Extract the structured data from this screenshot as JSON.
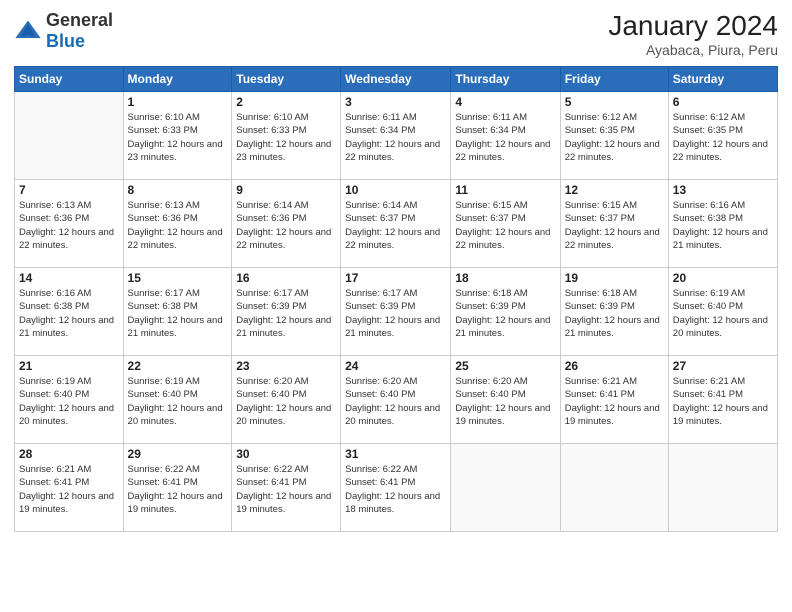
{
  "header": {
    "logo_general": "General",
    "logo_blue": "Blue",
    "month_year": "January 2024",
    "location": "Ayabaca, Piura, Peru"
  },
  "days_of_week": [
    "Sunday",
    "Monday",
    "Tuesday",
    "Wednesday",
    "Thursday",
    "Friday",
    "Saturday"
  ],
  "weeks": [
    [
      {
        "day": "",
        "sunrise": "",
        "sunset": "",
        "daylight": ""
      },
      {
        "day": "1",
        "sunrise": "Sunrise: 6:10 AM",
        "sunset": "Sunset: 6:33 PM",
        "daylight": "Daylight: 12 hours and 23 minutes."
      },
      {
        "day": "2",
        "sunrise": "Sunrise: 6:10 AM",
        "sunset": "Sunset: 6:33 PM",
        "daylight": "Daylight: 12 hours and 23 minutes."
      },
      {
        "day": "3",
        "sunrise": "Sunrise: 6:11 AM",
        "sunset": "Sunset: 6:34 PM",
        "daylight": "Daylight: 12 hours and 22 minutes."
      },
      {
        "day": "4",
        "sunrise": "Sunrise: 6:11 AM",
        "sunset": "Sunset: 6:34 PM",
        "daylight": "Daylight: 12 hours and 22 minutes."
      },
      {
        "day": "5",
        "sunrise": "Sunrise: 6:12 AM",
        "sunset": "Sunset: 6:35 PM",
        "daylight": "Daylight: 12 hours and 22 minutes."
      },
      {
        "day": "6",
        "sunrise": "Sunrise: 6:12 AM",
        "sunset": "Sunset: 6:35 PM",
        "daylight": "Daylight: 12 hours and 22 minutes."
      }
    ],
    [
      {
        "day": "7",
        "sunrise": "Sunrise: 6:13 AM",
        "sunset": "Sunset: 6:36 PM",
        "daylight": "Daylight: 12 hours and 22 minutes."
      },
      {
        "day": "8",
        "sunrise": "Sunrise: 6:13 AM",
        "sunset": "Sunset: 6:36 PM",
        "daylight": "Daylight: 12 hours and 22 minutes."
      },
      {
        "day": "9",
        "sunrise": "Sunrise: 6:14 AM",
        "sunset": "Sunset: 6:36 PM",
        "daylight": "Daylight: 12 hours and 22 minutes."
      },
      {
        "day": "10",
        "sunrise": "Sunrise: 6:14 AM",
        "sunset": "Sunset: 6:37 PM",
        "daylight": "Daylight: 12 hours and 22 minutes."
      },
      {
        "day": "11",
        "sunrise": "Sunrise: 6:15 AM",
        "sunset": "Sunset: 6:37 PM",
        "daylight": "Daylight: 12 hours and 22 minutes."
      },
      {
        "day": "12",
        "sunrise": "Sunrise: 6:15 AM",
        "sunset": "Sunset: 6:37 PM",
        "daylight": "Daylight: 12 hours and 22 minutes."
      },
      {
        "day": "13",
        "sunrise": "Sunrise: 6:16 AM",
        "sunset": "Sunset: 6:38 PM",
        "daylight": "Daylight: 12 hours and 21 minutes."
      }
    ],
    [
      {
        "day": "14",
        "sunrise": "Sunrise: 6:16 AM",
        "sunset": "Sunset: 6:38 PM",
        "daylight": "Daylight: 12 hours and 21 minutes."
      },
      {
        "day": "15",
        "sunrise": "Sunrise: 6:17 AM",
        "sunset": "Sunset: 6:38 PM",
        "daylight": "Daylight: 12 hours and 21 minutes."
      },
      {
        "day": "16",
        "sunrise": "Sunrise: 6:17 AM",
        "sunset": "Sunset: 6:39 PM",
        "daylight": "Daylight: 12 hours and 21 minutes."
      },
      {
        "day": "17",
        "sunrise": "Sunrise: 6:17 AM",
        "sunset": "Sunset: 6:39 PM",
        "daylight": "Daylight: 12 hours and 21 minutes."
      },
      {
        "day": "18",
        "sunrise": "Sunrise: 6:18 AM",
        "sunset": "Sunset: 6:39 PM",
        "daylight": "Daylight: 12 hours and 21 minutes."
      },
      {
        "day": "19",
        "sunrise": "Sunrise: 6:18 AM",
        "sunset": "Sunset: 6:39 PM",
        "daylight": "Daylight: 12 hours and 21 minutes."
      },
      {
        "day": "20",
        "sunrise": "Sunrise: 6:19 AM",
        "sunset": "Sunset: 6:40 PM",
        "daylight": "Daylight: 12 hours and 20 minutes."
      }
    ],
    [
      {
        "day": "21",
        "sunrise": "Sunrise: 6:19 AM",
        "sunset": "Sunset: 6:40 PM",
        "daylight": "Daylight: 12 hours and 20 minutes."
      },
      {
        "day": "22",
        "sunrise": "Sunrise: 6:19 AM",
        "sunset": "Sunset: 6:40 PM",
        "daylight": "Daylight: 12 hours and 20 minutes."
      },
      {
        "day": "23",
        "sunrise": "Sunrise: 6:20 AM",
        "sunset": "Sunset: 6:40 PM",
        "daylight": "Daylight: 12 hours and 20 minutes."
      },
      {
        "day": "24",
        "sunrise": "Sunrise: 6:20 AM",
        "sunset": "Sunset: 6:40 PM",
        "daylight": "Daylight: 12 hours and 20 minutes."
      },
      {
        "day": "25",
        "sunrise": "Sunrise: 6:20 AM",
        "sunset": "Sunset: 6:40 PM",
        "daylight": "Daylight: 12 hours and 19 minutes."
      },
      {
        "day": "26",
        "sunrise": "Sunrise: 6:21 AM",
        "sunset": "Sunset: 6:41 PM",
        "daylight": "Daylight: 12 hours and 19 minutes."
      },
      {
        "day": "27",
        "sunrise": "Sunrise: 6:21 AM",
        "sunset": "Sunset: 6:41 PM",
        "daylight": "Daylight: 12 hours and 19 minutes."
      }
    ],
    [
      {
        "day": "28",
        "sunrise": "Sunrise: 6:21 AM",
        "sunset": "Sunset: 6:41 PM",
        "daylight": "Daylight: 12 hours and 19 minutes."
      },
      {
        "day": "29",
        "sunrise": "Sunrise: 6:22 AM",
        "sunset": "Sunset: 6:41 PM",
        "daylight": "Daylight: 12 hours and 19 minutes."
      },
      {
        "day": "30",
        "sunrise": "Sunrise: 6:22 AM",
        "sunset": "Sunset: 6:41 PM",
        "daylight": "Daylight: 12 hours and 19 minutes."
      },
      {
        "day": "31",
        "sunrise": "Sunrise: 6:22 AM",
        "sunset": "Sunset: 6:41 PM",
        "daylight": "Daylight: 12 hours and 18 minutes."
      },
      {
        "day": "",
        "sunrise": "",
        "sunset": "",
        "daylight": ""
      },
      {
        "day": "",
        "sunrise": "",
        "sunset": "",
        "daylight": ""
      },
      {
        "day": "",
        "sunrise": "",
        "sunset": "",
        "daylight": ""
      }
    ]
  ]
}
